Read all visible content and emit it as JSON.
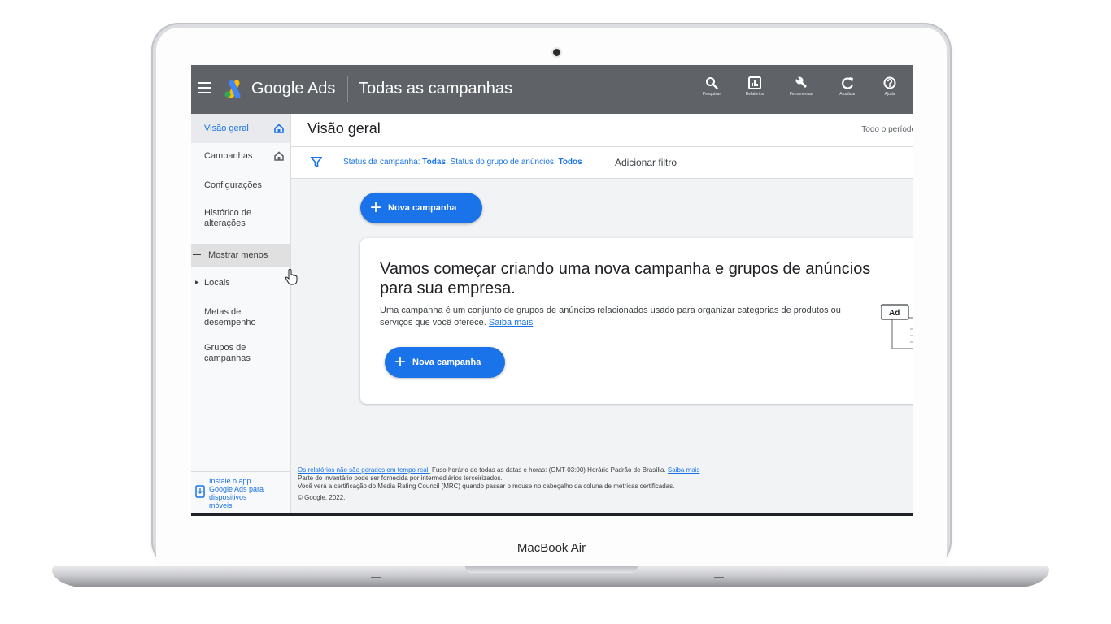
{
  "device": {
    "model_label": "MacBook Air"
  },
  "topbar": {
    "brand": "Google Ads",
    "scope": "Todas as campanhas",
    "tools": [
      {
        "icon": "search-icon",
        "label": "Pesquisar"
      },
      {
        "icon": "reports-icon",
        "label": "Relatórios"
      },
      {
        "icon": "wrench-icon",
        "label": "Ferramentas"
      },
      {
        "icon": "refresh-icon",
        "label": "Atualizar"
      },
      {
        "icon": "help-icon",
        "label": "Ajuda"
      }
    ]
  },
  "sidebar": {
    "items": [
      {
        "label": "Visão geral"
      },
      {
        "label": "Campanhas"
      },
      {
        "label": "Configurações"
      },
      {
        "label": "Histórico de alterações"
      },
      {
        "label": "Mostrar menos"
      },
      {
        "label": "Locais"
      },
      {
        "label": "Metas de desempenho"
      },
      {
        "label": "Grupos de campanhas"
      }
    ],
    "install_app": "Instale o app Google Ads para dispositivos móveis"
  },
  "header": {
    "title": "Visão geral",
    "date_range": "Todo o período"
  },
  "filter": {
    "prefix": "Status da campanha: ",
    "value1": "Todas",
    "middle": "; Status do grupo de anúncios: ",
    "value2": "Todos",
    "add_label": "Adicionar filtro"
  },
  "main": {
    "new_campaign_label": "Nova campanha",
    "card": {
      "heading": "Vamos começar criando uma nova campanha e grupos de anúncios para sua empresa.",
      "description": "Uma campanha é um conjunto de grupos de anúncios relacionados usado para organizar categorias de produtos ou serviços que você oferece.",
      "learn_more": "Saiba mais",
      "ad_badge": "Ad"
    }
  },
  "footer": {
    "realtime_link": "Os relatórios não são gerados em tempo real.",
    "timezone": " Fuso horário de todas as datas e horas: (GMT-03:00) Horário Padrão de Brasília. ",
    "learn_more": "Saiba mais",
    "inventory": "Parte do inventário pode ser fornecida por intermediários terceirizados.",
    "mrc": "Você verá a certificação do Media Rating Council (MRC) quando passar o mouse no cabeçalho da coluna de métricas certificadas.",
    "copyright": "© Google, 2022."
  },
  "colors": {
    "topbar": "#5f6368",
    "accent": "#1a73e8",
    "sidebar_bg": "#f8f9fa",
    "page_bg": "#f1f3f4"
  }
}
